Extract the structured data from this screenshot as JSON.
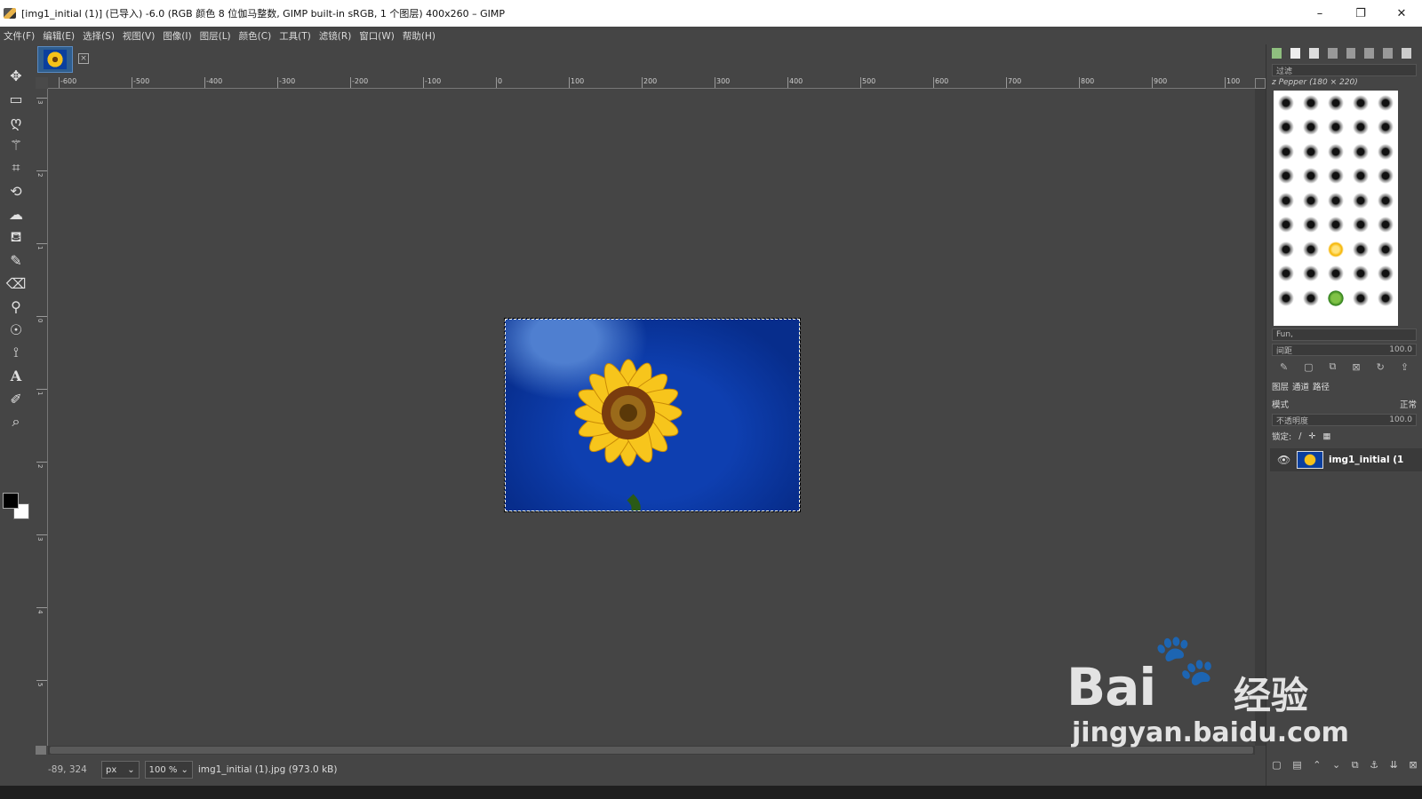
{
  "window": {
    "title": "[img1_initial (1)] (已导入) -6.0 (RGB 颜色 8 位伽马整数, GIMP built-in sRGB, 1 个图层) 400x260 – GIMP",
    "minimize": "–",
    "maximize": "❐",
    "close": "✕"
  },
  "menu": [
    "文件(F)",
    "编辑(E)",
    "选择(S)",
    "视图(V)",
    "图像(I)",
    "图层(L)",
    "颜色(C)",
    "工具(T)",
    "滤镜(R)",
    "窗口(W)",
    "帮助(H)"
  ],
  "tools": [
    {
      "name": "move-tool-icon",
      "glyph": "✥"
    },
    {
      "name": "rect-select-tool-icon",
      "glyph": "▭"
    },
    {
      "name": "lasso-tool-icon",
      "glyph": "ღ"
    },
    {
      "name": "fuzzy-select-tool-icon",
      "glyph": "⚚"
    },
    {
      "name": "crop-tool-icon",
      "glyph": "⌗"
    },
    {
      "name": "transform-tool-icon",
      "glyph": "⟲"
    },
    {
      "name": "warp-tool-icon",
      "glyph": "☁"
    },
    {
      "name": "bucket-fill-tool-icon",
      "glyph": "⛾"
    },
    {
      "name": "paintbrush-tool-icon",
      "glyph": "✎"
    },
    {
      "name": "eraser-tool-icon",
      "glyph": "⌫"
    },
    {
      "name": "clone-tool-icon",
      "glyph": "⚲"
    },
    {
      "name": "smudge-tool-icon",
      "glyph": "☉"
    },
    {
      "name": "paths-tool-icon",
      "glyph": "⟟"
    },
    {
      "name": "text-tool-icon",
      "glyph": "A"
    },
    {
      "name": "color-picker-tool-icon",
      "glyph": "✐"
    },
    {
      "name": "zoom-tool-icon",
      "glyph": "⌕"
    }
  ],
  "hruler_labels": [
    "-600",
    "-500",
    "-400",
    "-300",
    "-200",
    "-100",
    "0",
    "100",
    "200",
    "300",
    "400",
    "500",
    "600",
    "700",
    "800",
    "900",
    "100"
  ],
  "vruler_labels": [
    "3",
    "2",
    "1",
    "0",
    "1",
    "2",
    "3",
    "4",
    "5"
  ],
  "status": {
    "coords": "-89, 324",
    "unit": "px",
    "zoom": "100 %",
    "file": "img1_initial (1).jpg (973.0 kB)"
  },
  "brushes": {
    "filter_placeholder": "过滤",
    "brush_title": "z Pepper (180 × 220)",
    "preset": "Fun,",
    "spacing_label": "间距",
    "spacing_value": "100.0"
  },
  "layers_panel": {
    "tabs": [
      "图层",
      "通道",
      "路径"
    ],
    "mode_label": "模式",
    "mode_value": "正常",
    "opacity_label": "不透明度",
    "opacity_value": "100.0",
    "lock_label": "锁定:",
    "layer_name": "img1_initial (1"
  },
  "watermark": {
    "bai": "Bai",
    "paw": "🐾",
    "cn": "经验",
    "url": "jingyan.baidu.com"
  }
}
